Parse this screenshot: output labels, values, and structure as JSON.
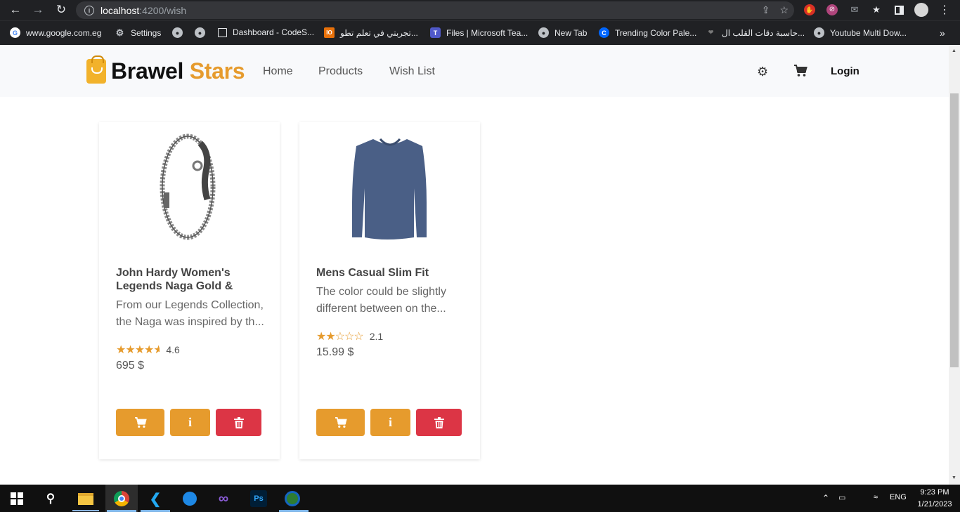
{
  "browser": {
    "url_host": "localhost",
    "url_rest": ":4200/wish",
    "bookmarks": [
      {
        "label": "www.google.com.eg",
        "icon": "google-icon"
      },
      {
        "label": "Settings",
        "icon": "gear-icon"
      },
      {
        "label": "",
        "icon": "globe-icon"
      },
      {
        "label": "",
        "icon": "globe-icon"
      },
      {
        "label": "Dashboard - CodeS...",
        "icon": "page-icon"
      },
      {
        "label": "تجربتي في تعلم تطو...",
        "icon": "site-icon"
      },
      {
        "label": "Files | Microsoft Tea...",
        "icon": "teams-icon"
      },
      {
        "label": "New Tab",
        "icon": "globe-icon"
      },
      {
        "label": "Trending Color Pale...",
        "icon": "coolors-icon"
      },
      {
        "label": "حاسبة دقات القلب ال...",
        "icon": "heart-icon"
      },
      {
        "label": "Youtube Multi Dow...",
        "icon": "globe-icon"
      }
    ],
    "more_bookmarks": "»"
  },
  "navbar": {
    "brand_main": "Brawel",
    "brand_accent": "Stars",
    "links": [
      "Home",
      "Products",
      "Wish List"
    ],
    "login": "Login"
  },
  "wishlist": [
    {
      "title": "John Hardy Women's Legends Naga Gold & Silve...",
      "description": "From our Legends Collection, the Naga was inspired by th...",
      "rating": 4.6,
      "rating_text": "4.6",
      "price": "695 $"
    },
    {
      "title": "Mens Casual Slim Fit",
      "description": "The color could be slightly different between on the...",
      "rating": 2.1,
      "rating_text": "2.1",
      "price": "15.99 $"
    }
  ],
  "buttons": {
    "info_label": "i"
  },
  "taskbar": {
    "lang": "ENG",
    "time": "9:23 PM",
    "date": "1/21/2023"
  },
  "colors": {
    "accent": "#e69b2d",
    "danger": "#dc3545",
    "chrome_dark": "#202124"
  }
}
